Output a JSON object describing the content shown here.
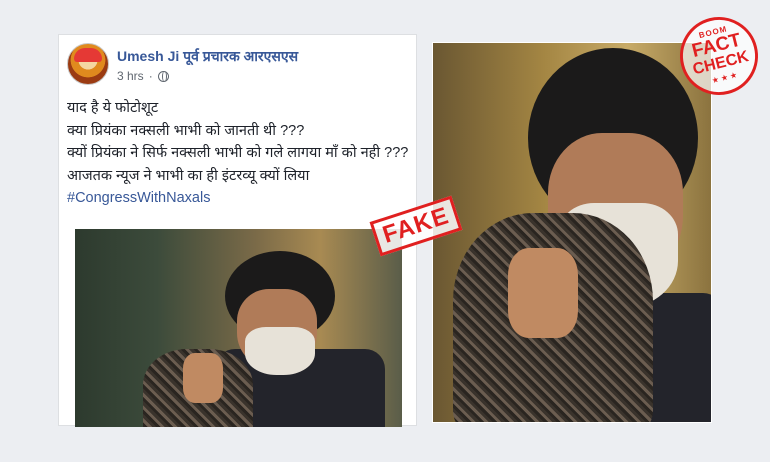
{
  "post": {
    "author": "Umesh Ji पूर्व प्रचारक आरएसएस",
    "time": "3 hrs",
    "privacy_icon": "globe-icon",
    "lines": [
      "याद है ये फोटोशूट",
      "क्या प्रियंका नक्सली भाभी को जानती थी ???",
      "क्यों प्रियंका ने सिर्फ नक्सली भाभी को गले लागया माँ को नही ???",
      "आजतक न्यूज ने भाभी का ही इंटरव्यू क्यों लिया"
    ],
    "hashtag": "#CongressWithNaxals"
  },
  "stamps": {
    "fake": "FAKE",
    "badge_small": "BOOM",
    "badge_fact": "FACT",
    "badge_check": "CHECK",
    "badge_stars": "★ ★ ★"
  },
  "colors": {
    "link_blue": "#385898",
    "stamp_red": "#e02020",
    "background": "#eceef2"
  }
}
